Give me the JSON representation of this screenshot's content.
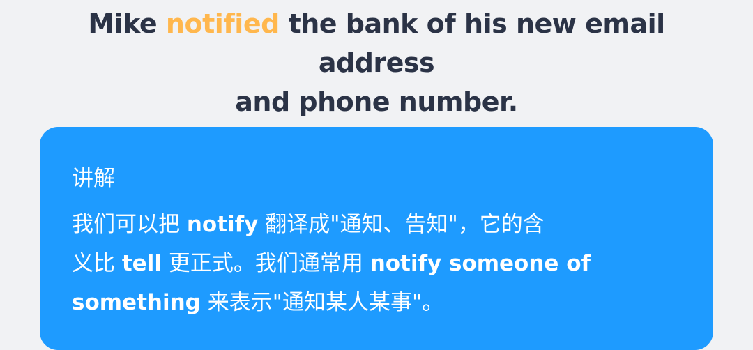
{
  "sentence": {
    "part1": "Mike ",
    "highlight": "notified",
    "part2": " the bank of his new email address",
    "line2": "and phone number."
  },
  "explanation": {
    "title": "讲解",
    "seg1": "我们可以把 ",
    "bold1": "notify",
    "seg2": " 翻译成\"通知、告知\"，它的含",
    "seg3": "义比 ",
    "bold2": "tell",
    "seg4": " 更正式。我们通常用 ",
    "bold3": "notify someone of",
    "bold4": "something",
    "seg5": " 来表示\"通知某人某事\"。"
  },
  "colors": {
    "background": "#f1f2f4",
    "text_dark": "#2b3346",
    "highlight": "#ffb74d",
    "card": "#1e9bff",
    "card_text": "#ffffff"
  }
}
